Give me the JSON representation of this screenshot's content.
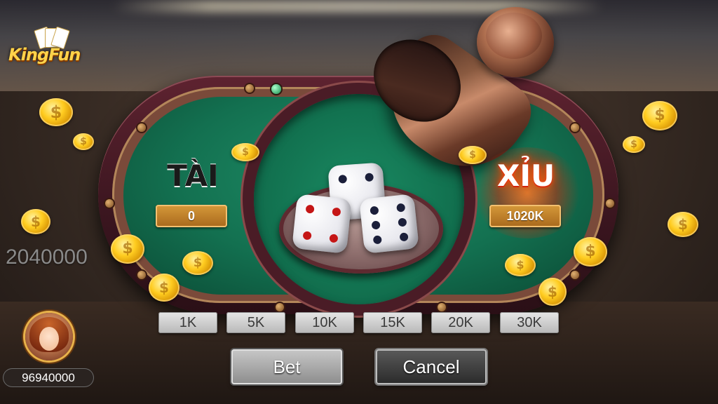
{
  "brand": {
    "logo_text": "KingFun"
  },
  "table": {
    "tai": {
      "label": "TÀI",
      "amount": "0"
    },
    "xiu": {
      "label": "XỈU",
      "amount": "1020K"
    }
  },
  "pot_total": "2040000",
  "dice": [
    {
      "face": 4
    },
    {
      "face": 4
    },
    {
      "face": 6
    }
  ],
  "chips": [
    "1K",
    "5K",
    "10K",
    "15K",
    "20K",
    "30K"
  ],
  "actions": {
    "bet_label": "Bet",
    "cancel_label": "Cancel"
  },
  "player": {
    "balance": "96940000"
  },
  "colors": {
    "felt": "#137050",
    "rim": "#4a1c26",
    "gold_box": "#c58329",
    "xiu_glow": "#ff5a00"
  }
}
